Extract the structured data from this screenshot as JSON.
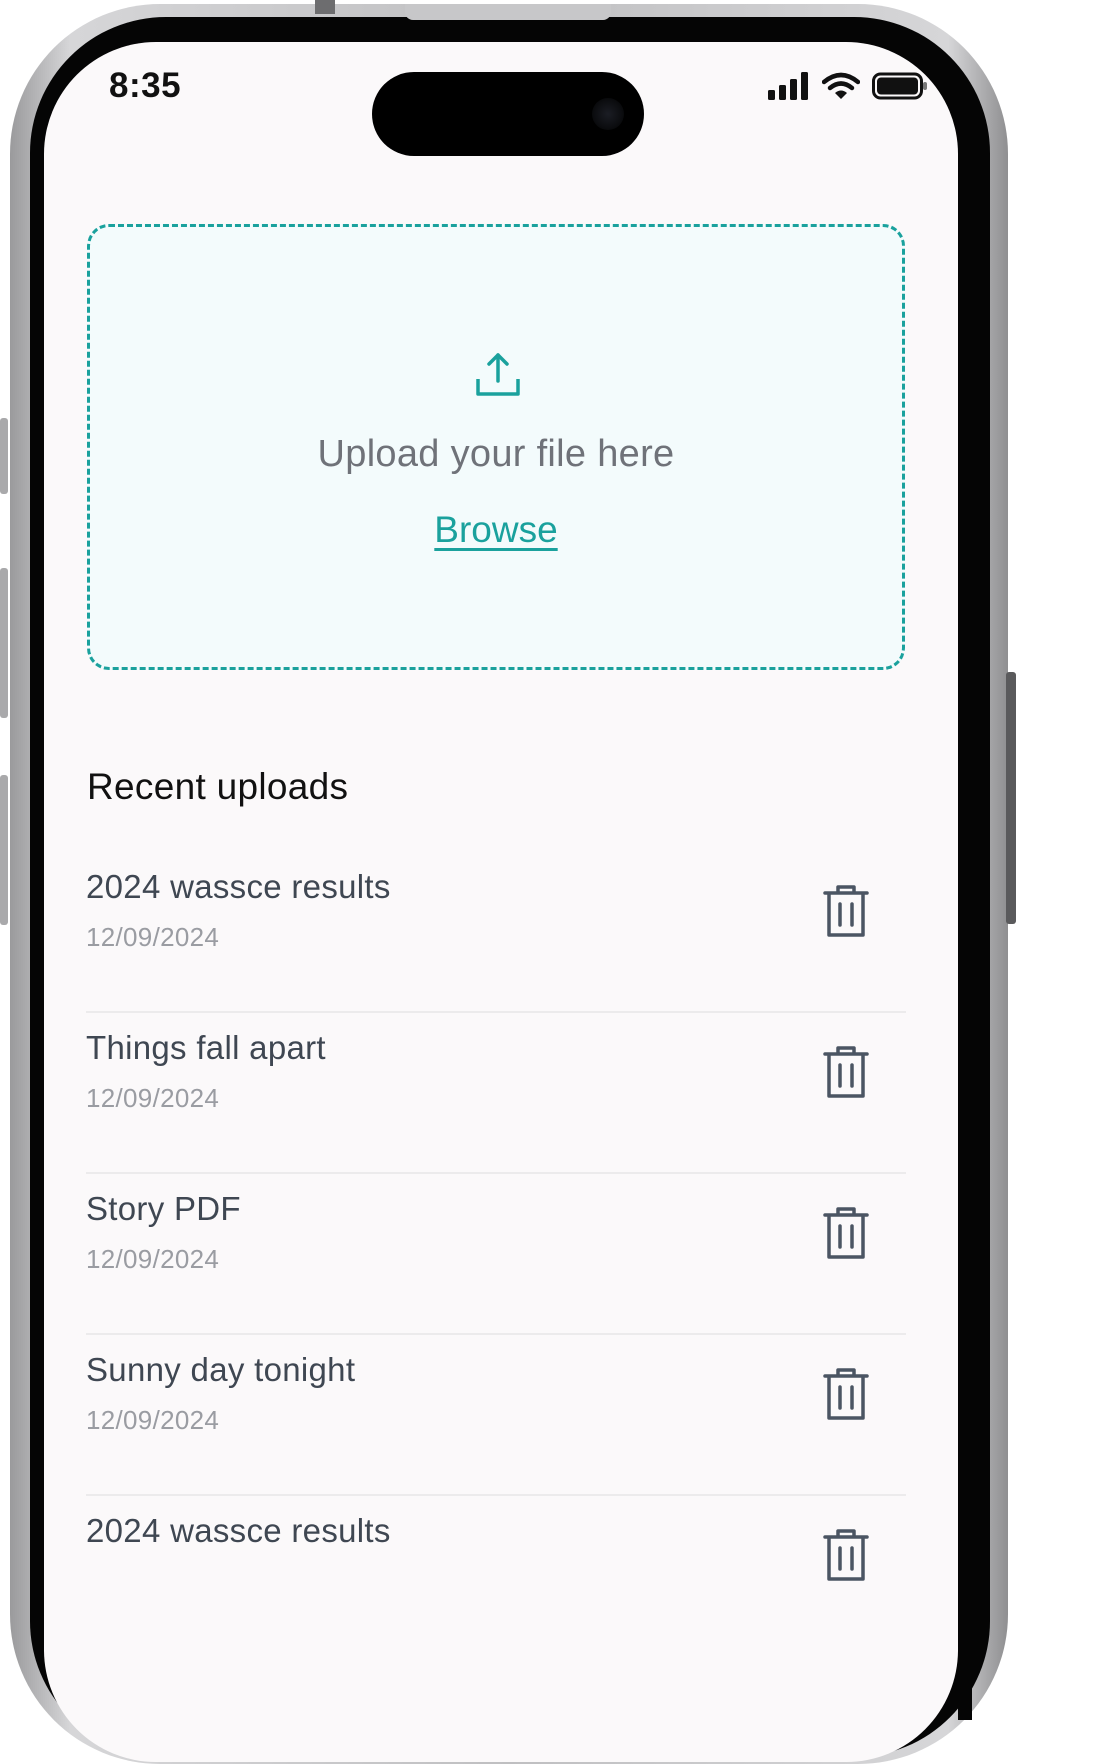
{
  "status_bar": {
    "time": "8:35",
    "icons": [
      "signal-icon",
      "wifi-icon",
      "battery-icon"
    ]
  },
  "upload_zone": {
    "icon": "upload-icon",
    "prompt": "Upload your file here",
    "browse_label": "Browse"
  },
  "recent_uploads": {
    "title": "Recent uploads",
    "items": [
      {
        "name": "2024 wassce results",
        "date": "12/09/2024"
      },
      {
        "name": "Things fall apart",
        "date": "12/09/2024"
      },
      {
        "name": "Story PDF",
        "date": "12/09/2024"
      },
      {
        "name": "Sunny day tonight",
        "date": "12/09/2024"
      },
      {
        "name": "2024 wassce results",
        "date": ""
      }
    ]
  },
  "colors": {
    "accent": "#1aa19d",
    "upload_zone_bg": "#f3fbfc",
    "screen_bg": "#fbf9fa",
    "item_title": "#3f4752",
    "item_date": "#9a9ca2",
    "icon_gray": "#4b5563"
  }
}
